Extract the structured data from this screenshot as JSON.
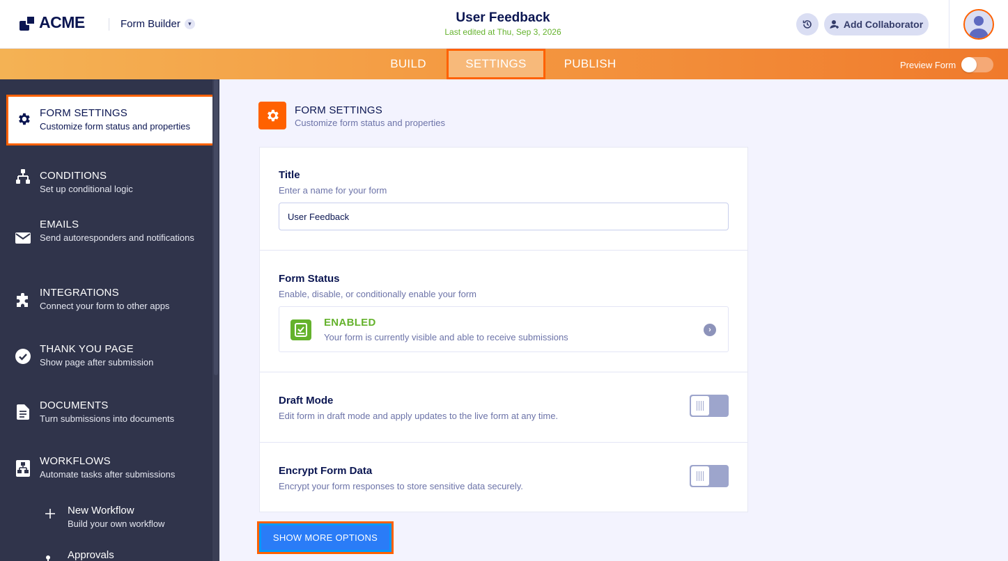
{
  "header": {
    "logo_text": "ACME",
    "builder_label": "Form Builder",
    "form_title": "User Feedback",
    "last_edited": "Last edited at Thu, Sep 3, 2026",
    "collaborator_label": "Add Collaborator"
  },
  "nav": {
    "tabs": [
      {
        "label": "BUILD"
      },
      {
        "label": "SETTINGS",
        "active": true
      },
      {
        "label": "PUBLISH"
      }
    ],
    "preview_label": "Preview Form",
    "preview_on": false
  },
  "sidebar": {
    "items": [
      {
        "title": "FORM SETTINGS",
        "desc": "Customize form status and properties",
        "icon": "gear-icon",
        "active": true
      },
      {
        "title": "CONDITIONS",
        "desc": "Set up conditional logic",
        "icon": "conditions-icon"
      },
      {
        "title": "EMAILS",
        "desc": "Send autoresponders and notifications",
        "icon": "envelope-icon"
      },
      {
        "title": "INTEGRATIONS",
        "desc": "Connect your form to other apps",
        "icon": "puzzle-icon"
      },
      {
        "title": "THANK YOU PAGE",
        "desc": "Show page after submission",
        "icon": "check-circle-icon"
      },
      {
        "title": "DOCUMENTS",
        "desc": "Turn submissions into documents",
        "icon": "document-icon"
      },
      {
        "title": "WORKFLOWS",
        "desc": "Automate tasks after submissions",
        "icon": "workflow-icon"
      }
    ],
    "sub_items": [
      {
        "title": "New Workflow",
        "desc": "Build your own workflow",
        "icon": "plus-icon"
      },
      {
        "title": "Approvals",
        "desc": "",
        "icon": "approvals-icon"
      }
    ]
  },
  "main": {
    "section_title": "FORM SETTINGS",
    "section_desc": "Customize form status and properties",
    "title_field": {
      "label": "Title",
      "desc": "Enter a name for your form",
      "value": "User Feedback"
    },
    "form_status": {
      "label": "Form Status",
      "desc": "Enable, disable, or conditionally enable your form",
      "status": "ENABLED",
      "status_desc": "Your form is currently visible and able to receive submissions"
    },
    "draft_mode": {
      "label": "Draft Mode",
      "desc": "Edit form in draft mode and apply updates to the live form at any time.",
      "enabled": false
    },
    "encrypt": {
      "label": "Encrypt Form Data",
      "desc": "Encrypt your form responses to store sensitive data securely.",
      "enabled": false
    },
    "more_button": "SHOW MORE OPTIONS"
  },
  "colors": {
    "accent": "#ff6100",
    "navy": "#0a1551",
    "sidebar_bg": "#30344b",
    "enabled_green": "#64b22c",
    "button_blue": "#2a7cf7"
  }
}
